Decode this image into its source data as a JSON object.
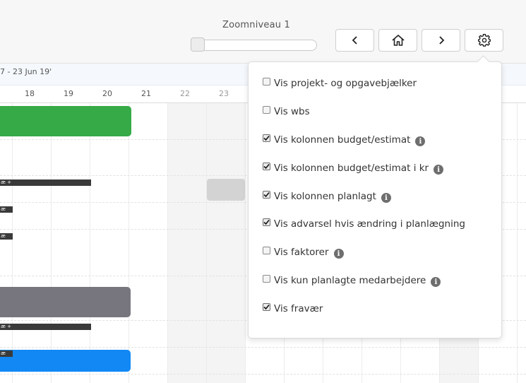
{
  "toolbar": {
    "zoom_label": "Zoomniveau  1",
    "zoom_level": 1,
    "buttons": [
      {
        "name": "previous",
        "icon": "chevron-left-icon"
      },
      {
        "name": "home",
        "icon": "home-icon"
      },
      {
        "name": "next",
        "icon": "chevron-right-icon"
      },
      {
        "name": "settings",
        "icon": "gear-icon"
      }
    ]
  },
  "timeline": {
    "range_label": "7 - 23 Jun 19'",
    "days": [
      "18",
      "19",
      "20",
      "21",
      "22",
      "23"
    ],
    "bar_label": "æ +",
    "bar_label_short": "æ"
  },
  "colors": {
    "green_bar": "#35aa47",
    "gray_bar": "#77767f",
    "blue_bar": "#1288f5",
    "light_gray_bar": "#d3d3d3"
  },
  "settings_menu": {
    "options": [
      {
        "label": "Vis projekt- og opgavebjælker",
        "checked": false,
        "info": false
      },
      {
        "label": "Vis wbs",
        "checked": false,
        "info": false
      },
      {
        "label": "Vis kolonnen budget/estimat",
        "checked": true,
        "info": true
      },
      {
        "label": "Vis kolonnen budget/estimat i kr",
        "checked": true,
        "info": true
      },
      {
        "label": "Vis kolonnen planlagt",
        "checked": true,
        "info": true
      },
      {
        "label": "Vis advarsel hvis ændring i planlægning",
        "checked": true,
        "info": false
      },
      {
        "label": "Vis faktorer",
        "checked": false,
        "info": true
      },
      {
        "label": "Vis kun planlagte medarbejdere",
        "checked": false,
        "info": true
      },
      {
        "label": "Vis fravær",
        "checked": true,
        "info": false
      }
    ]
  }
}
